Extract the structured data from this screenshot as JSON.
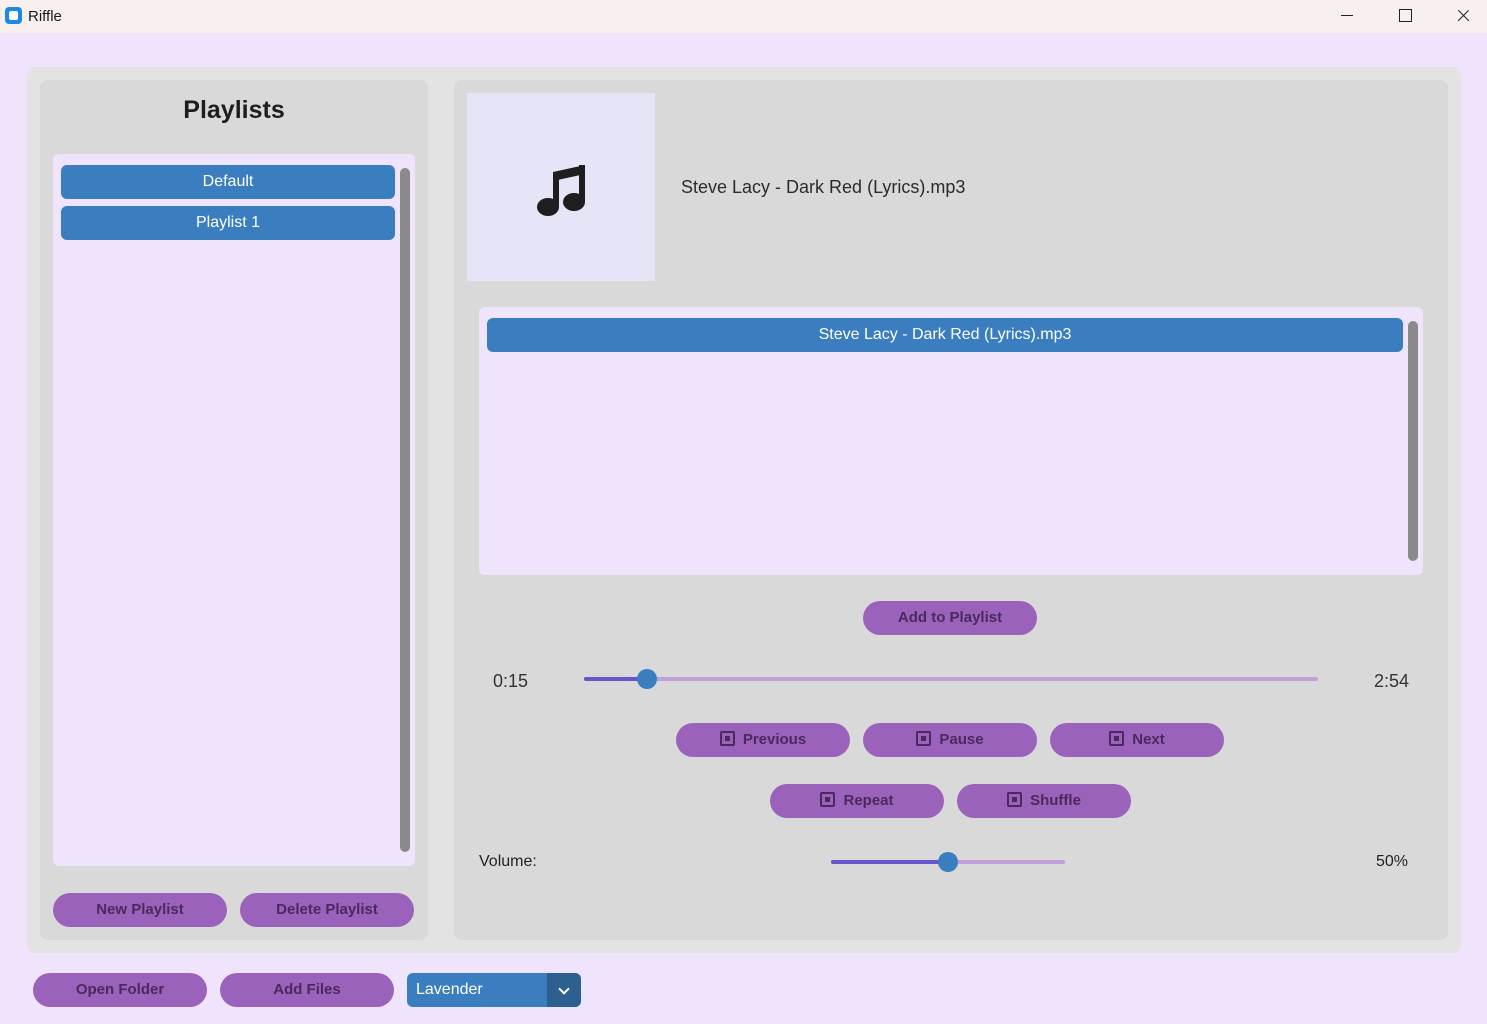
{
  "window": {
    "title": "Riffle"
  },
  "playlists": {
    "title": "Playlists",
    "items": [
      {
        "label": "Default"
      },
      {
        "label": "Playlist 1"
      }
    ],
    "new_button": "New Playlist",
    "delete_button": "Delete Playlist"
  },
  "now_playing": {
    "track": "Steve Lacy - Dark Red (Lyrics).mp3",
    "art_icon": "music-note-icon"
  },
  "queue": {
    "items": [
      {
        "label": "Steve Lacy - Dark Red (Lyrics).mp3"
      }
    ]
  },
  "actions": {
    "add_to_playlist": "Add to Playlist"
  },
  "progress": {
    "elapsed": "0:15",
    "duration": "2:54",
    "fraction": 0.086
  },
  "controls": {
    "previous": "Previous",
    "pause": "Pause",
    "next": "Next",
    "repeat": "Repeat",
    "shuffle": "Shuffle"
  },
  "volume": {
    "label": "Volume:",
    "value_text": "50%",
    "value": 0.5
  },
  "footer": {
    "open_folder": "Open Folder",
    "add_files": "Add Files",
    "theme_selected": "Lavender"
  },
  "colors": {
    "accent_blue": "#3a7ebf",
    "button_purple": "#9b62bb",
    "background_lavender": "#efe4fb"
  }
}
